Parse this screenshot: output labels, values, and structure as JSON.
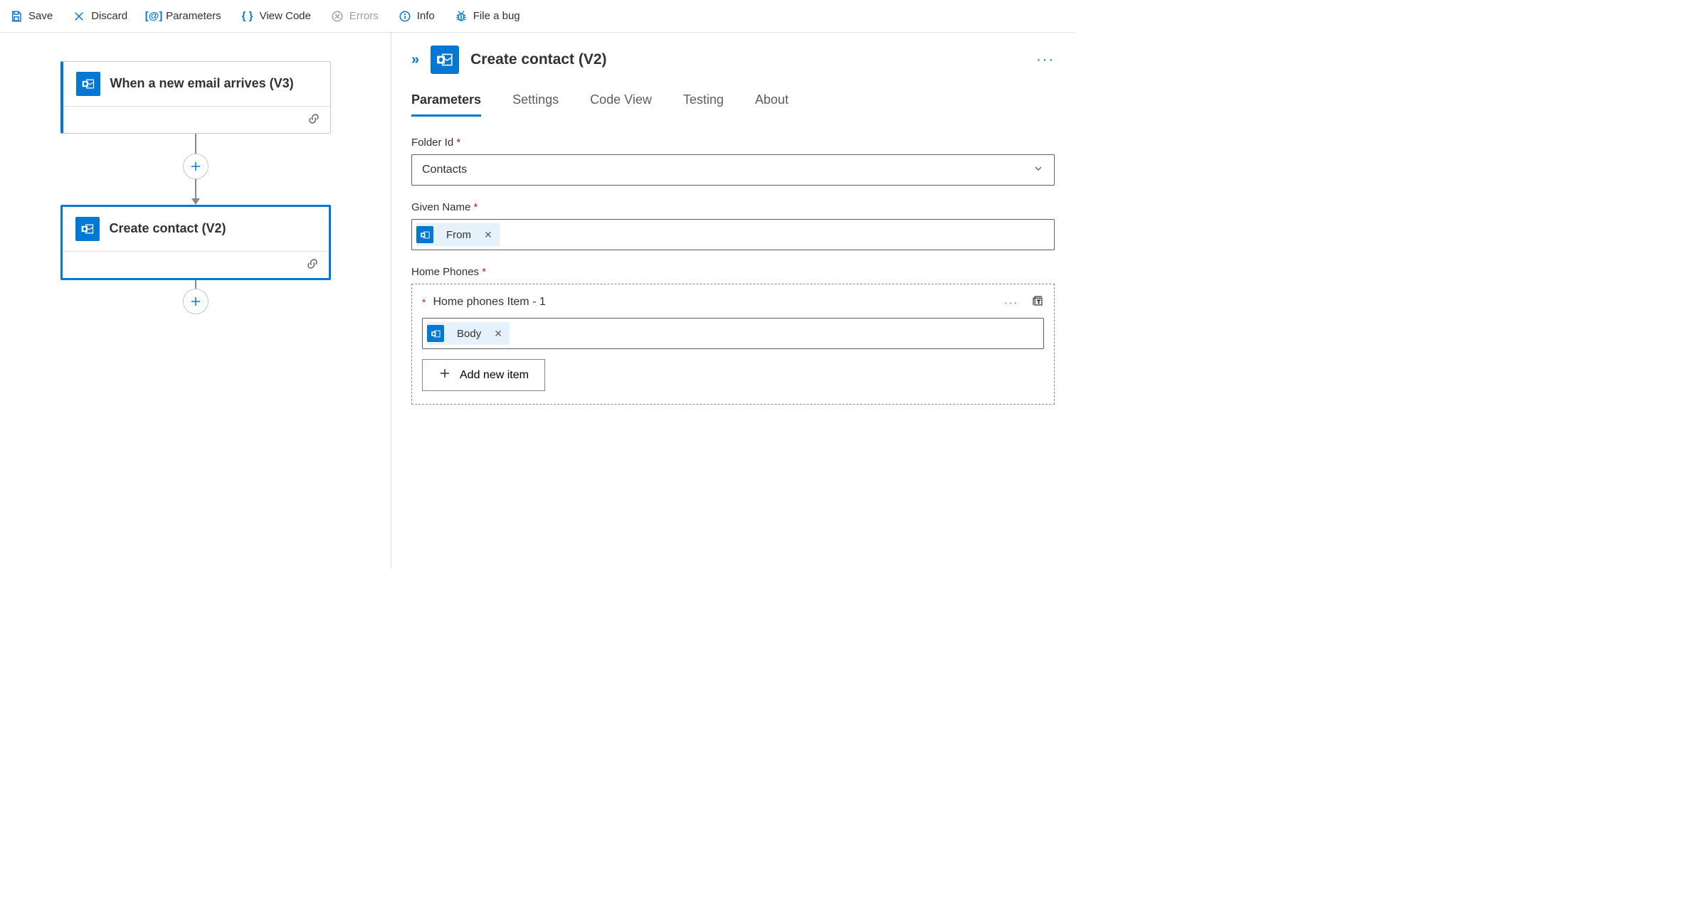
{
  "toolbar": {
    "save": "Save",
    "discard": "Discard",
    "parameters": "Parameters",
    "view_code": "View Code",
    "errors": "Errors",
    "info": "Info",
    "file_bug": "File a bug"
  },
  "flow": {
    "trigger_title": "When a new email arrives (V3)",
    "action_title": "Create contact (V2)"
  },
  "panel": {
    "title": "Create contact (V2)",
    "tabs": {
      "parameters": "Parameters",
      "settings": "Settings",
      "code_view": "Code View",
      "testing": "Testing",
      "about": "About"
    },
    "fields": {
      "folder_id_label": "Folder Id",
      "folder_id_value": "Contacts",
      "given_name_label": "Given Name",
      "given_name_token": "From",
      "home_phones_label": "Home Phones",
      "home_phones_item_label": "Home phones Item - 1",
      "home_phones_item_token": "Body",
      "add_new_item": "Add new item"
    }
  }
}
